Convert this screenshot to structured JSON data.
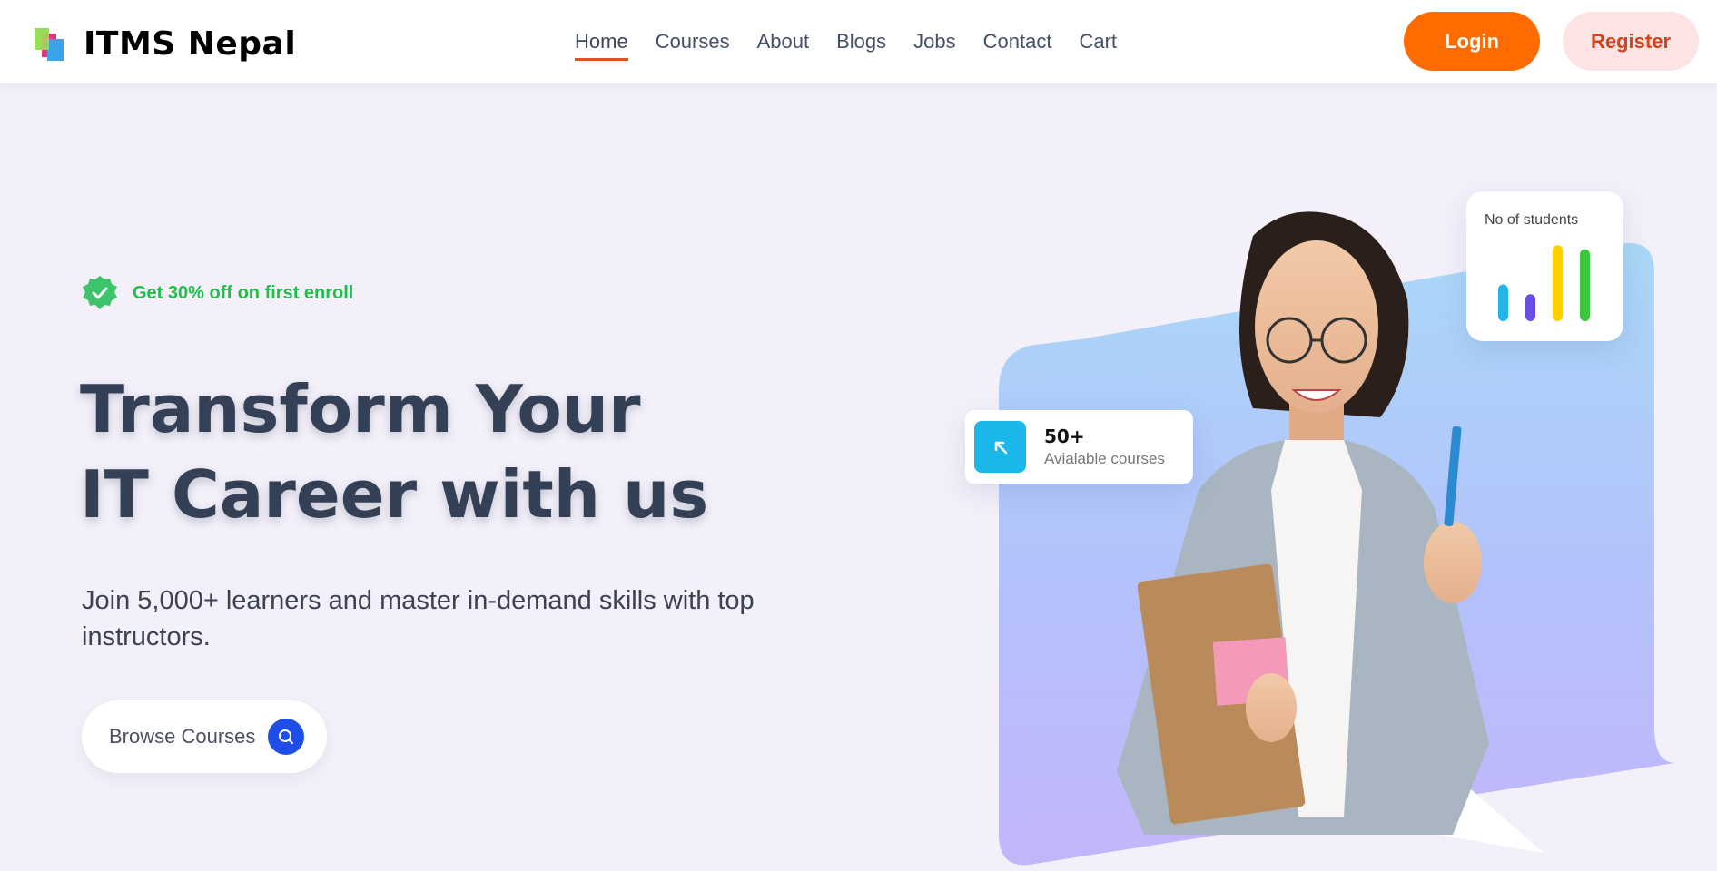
{
  "brand": {
    "name": "ITMS Nepal"
  },
  "nav": {
    "items": [
      {
        "label": "Home",
        "active": true
      },
      {
        "label": "Courses"
      },
      {
        "label": "About"
      },
      {
        "label": "Blogs"
      },
      {
        "label": "Jobs"
      },
      {
        "label": "Contact"
      },
      {
        "label": "Cart"
      }
    ]
  },
  "auth": {
    "login_label": "Login",
    "register_label": "Register"
  },
  "hero": {
    "promo": "Get 30% off on first enroll",
    "headline_line1": "Transform Your",
    "headline_line2": "IT Career with us",
    "subtext": "Join 5,000+ learners and master in-demand skills with top instructors.",
    "browse_label": "Browse Courses"
  },
  "stats": {
    "courses_count": "50+",
    "courses_label": "Avialable courses",
    "students_label": "No of students",
    "students_bars": [
      {
        "value": 0.45,
        "color": "#23b5e8"
      },
      {
        "value": 0.33,
        "color": "#6b4ee6"
      },
      {
        "value": 0.93,
        "color": "#ffd000"
      },
      {
        "value": 0.88,
        "color": "#3cc63c"
      }
    ]
  },
  "colors": {
    "accent": "#ff6b00",
    "register_bg": "#fde4e4",
    "promo_green": "#1fbf4a",
    "browse_icon_bg": "#1d4ee6"
  }
}
